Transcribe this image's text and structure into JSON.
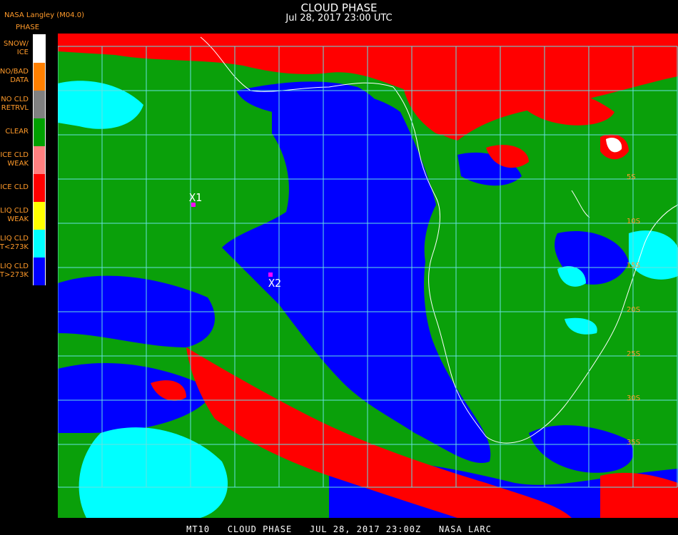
{
  "header": {
    "source": "NASA Langley (M04.0)",
    "title": "CLOUD PHASE",
    "datetime": "Jul 28, 2017 23:00 UTC"
  },
  "legend": {
    "heading": "PHASE",
    "items": [
      {
        "label": "SNOW/\nICE",
        "color": "#ffffff"
      },
      {
        "label": "NO/BAD\nDATA",
        "color": "#ff8000"
      },
      {
        "label": "NO CLD\nRETRVL",
        "color": "#808080"
      },
      {
        "label": "CLEAR",
        "color": "#00a000"
      },
      {
        "label": "ICE CLD\nWEAK",
        "color": "#ff8080"
      },
      {
        "label": "ICE CLD",
        "color": "#ff0000"
      },
      {
        "label": "LIQ CLD\nWEAK",
        "color": "#ffff00"
      },
      {
        "label": "LIQ CLD\nT<273K",
        "color": "#00ffff"
      },
      {
        "label": "LIQ CLD\nT>273K",
        "color": "#0000ff"
      }
    ]
  },
  "markers": [
    {
      "label": "X1"
    },
    {
      "label": "X2"
    }
  ],
  "lat_labels": [
    "5S",
    "10S",
    "15S",
    "20S",
    "25S",
    "30S",
    "35S"
  ],
  "footer": "MT10   CLOUD PHASE   JUL 28, 2017 23:00Z   NASA LARC",
  "colors": {
    "grid": "#66e0e0",
    "clear": "#0aa00a",
    "liq_warm": "#0000ff",
    "liq_cold": "#00ffff",
    "ice": "#ff0000",
    "coast": "#ffffff",
    "label_orange": "#ff9a2a"
  }
}
